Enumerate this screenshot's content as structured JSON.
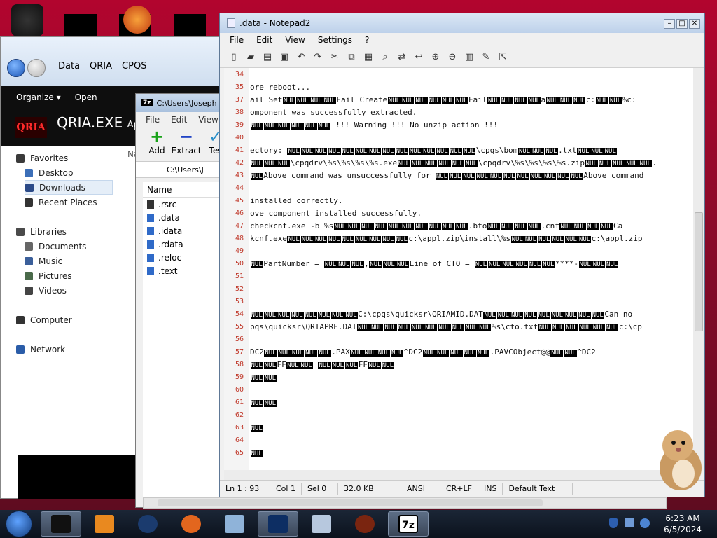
{
  "explorer": {
    "breadcrumb": [
      "Data",
      "QRIA",
      "CPQS"
    ],
    "toolbar": {
      "organize": "Organize ▾",
      "open": "Open"
    },
    "banner_logo": "QRIA",
    "banner_title": "QRIA.EXE",
    "banner_suffix": "Ap",
    "column_cut": "Na",
    "nav": [
      {
        "label": "Favorites",
        "icon": "favorites-icon"
      },
      {
        "label": "Desktop",
        "icon": "desktop-icon"
      },
      {
        "label": "Downloads",
        "icon": "downloads-icon",
        "selected": true
      },
      {
        "label": "Recent Places",
        "icon": "recent-places-icon"
      },
      {
        "label": "Libraries",
        "icon": "libraries-icon"
      },
      {
        "label": "Documents",
        "icon": "documents-icon"
      },
      {
        "label": "Music",
        "icon": "music-icon"
      },
      {
        "label": "Pictures",
        "icon": "pictures-icon"
      },
      {
        "label": "Videos",
        "icon": "videos-icon"
      },
      {
        "label": "Computer",
        "icon": "computer-icon"
      },
      {
        "label": "Network",
        "icon": "network-icon"
      }
    ]
  },
  "zip": {
    "title": "C:\\Users\\Joseph",
    "badge": "7z",
    "menu": [
      "File",
      "Edit",
      "View"
    ],
    "tools": [
      {
        "label": "Add",
        "glyph": "+",
        "color": "#1aa31a"
      },
      {
        "label": "Extract",
        "glyph": "−",
        "color": "#1b3fc4"
      },
      {
        "label": "Tes",
        "glyph": "✓",
        "color": "#2a8fc9"
      }
    ],
    "path": "C:\\Users\\J",
    "column": "Name",
    "files": [
      ".rsrc",
      ".data",
      ".idata",
      ".rdata",
      ".reloc",
      ".text"
    ]
  },
  "notepad": {
    "title": ".data - Notepad2",
    "menu": [
      "File",
      "Edit",
      "View",
      "Settings",
      "?"
    ],
    "lines": [
      {
        "n": "34",
        "text": ""
      },
      {
        "n": "35",
        "text": "ore reboot..."
      },
      {
        "n": "37",
        "text": "ail Set{N4}Fail Create{N6}Fail{N4}a{N3}c:{N2}%c:"
      },
      {
        "n": "38",
        "text": "omponent was successfully extracted."
      },
      {
        "n": "39",
        "text": "{N6} !!! Warning !!! No unzip action !!!"
      },
      {
        "n": "40",
        "text": ""
      },
      {
        "n": "41",
        "text": "ectory: {N14}\\cpqs\\bom{N3}.txt{N3}"
      },
      {
        "n": "42",
        "text": "{N3}\\cpqdrv\\%s\\%s\\%s\\%s.exe{N6}\\cpqdrv\\%s\\%s\\%s\\%s.zip{N5}."
      },
      {
        "n": "43",
        "text": "{N1}Above command was unsuccessfully for {N11}Above command"
      },
      {
        "n": "44",
        "text": ""
      },
      {
        "n": "45",
        "text": " installed correctly."
      },
      {
        "n": "46",
        "text": "ove component installed successfully."
      },
      {
        "n": "47",
        "text": "checkcnf.exe -b %s{N10}.bto{N4}.cnf{N4}Ca"
      },
      {
        "n": "48",
        "text": "kcnf.exe{N9}c:\\appl.zip\\install\\%s{N6}c:\\appl.zip"
      },
      {
        "n": "49",
        "text": ""
      },
      {
        "n": "50",
        "text": "{N1}PartNumber = {N3},{N3}Line of CTO = {N6}****-{N3}"
      },
      {
        "n": "51",
        "text": ""
      },
      {
        "n": "52",
        "text": ""
      },
      {
        "n": "53",
        "text": ""
      },
      {
        "n": "54",
        "text": "{N8}C:\\cpqs\\quicksr\\QRIAMID.DAT{N9}Can no"
      },
      {
        "n": "55",
        "text": "pqs\\quicksr\\QRIAPRE.DAT{N10}%s\\cto.txt{N6}c:\\cp"
      },
      {
        "n": "56",
        "text": ""
      },
      {
        "n": "57",
        "text": "DC2{N5}.PAX{N4}^DC2{N5}.PAVCObject@@{N2}^DC2"
      },
      {
        "n": "58",
        "text": "{N2}FF{N2}  {N3}FF{N2}"
      },
      {
        "n": "59",
        "text": "{N2}"
      },
      {
        "n": "60",
        "text": ""
      },
      {
        "n": "61",
        "text": "{N2}"
      },
      {
        "n": "62",
        "text": ""
      },
      {
        "n": "63",
        "text": "{N1}"
      },
      {
        "n": "64",
        "text": ""
      },
      {
        "n": "65",
        "text": "{N1}"
      }
    ],
    "status": [
      "Ln 1 : 93",
      "Col 1",
      "Sel 0",
      "32.0 KB",
      "ANSI",
      "CR+LF",
      "INS",
      "Default Text"
    ]
  },
  "taskbar": {
    "time": "6:23 AM",
    "date": "6/5/2024",
    "apps": [
      "app-icon",
      "media-player-icon",
      "globe-icon",
      "firefox-icon",
      "notes-icon",
      "monitor-icon",
      "media-icon",
      "fire-icon",
      "7zip-icon"
    ]
  }
}
